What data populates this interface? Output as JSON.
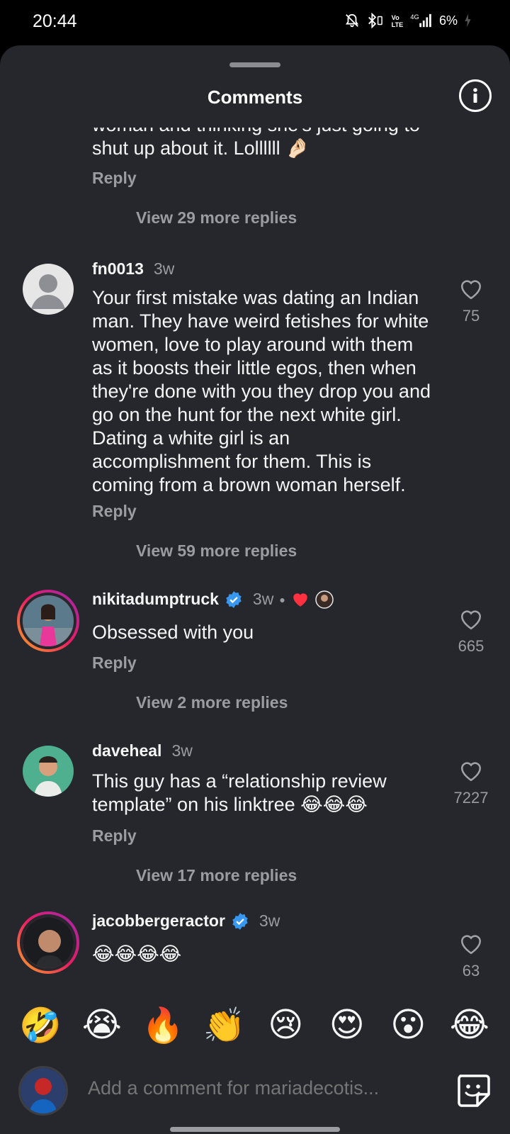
{
  "status": {
    "time": "20:44",
    "network": "4G",
    "battery": "6%",
    "icons": [
      "bell-off-icon",
      "bluetooth-icon",
      "volte-icon",
      "signal-icon",
      "battery-icon"
    ]
  },
  "sheet": {
    "title": "Comments"
  },
  "comments": [
    {
      "text_partial": "woman and thinking she's just going to shut up about it. Lollllll 🤌🏻",
      "reply_label": "Reply",
      "view_replies": "View 29 more replies"
    },
    {
      "username": "fn0013",
      "time": "3w",
      "text": "Your first mistake was dating an Indian man. They have weird fetishes for white women, love to play around with them as it boosts their little egos, then when they're done with you they drop you and go on the hunt for the next white girl. Dating a white girl is an accomplishment for them. This is coming from a brown woman herself.",
      "likes": "75",
      "reply_label": "Reply",
      "view_replies": "View 59 more replies"
    },
    {
      "username": "nikitadumptruck",
      "verified": true,
      "time": "3w",
      "text": "Obsessed with you",
      "likes": "665",
      "reply_label": "Reply",
      "view_replies": "View 2 more replies"
    },
    {
      "username": "daveheal",
      "time": "3w",
      "text": "This guy has a “relationship review template” on his linktree 😂😂😂",
      "likes": "7227",
      "reply_label": "Reply",
      "view_replies": "View 17 more replies"
    },
    {
      "username": "jacobbergeractor",
      "verified": true,
      "time": "3w",
      "text": "😂😂😂😂",
      "likes": "63"
    }
  ],
  "quick_emojis": [
    "🤣",
    "😭",
    "🔥",
    "👏",
    "😢",
    "😍",
    "😮",
    "😂"
  ],
  "composer": {
    "placeholder": "Add a comment for mariadecotis..."
  }
}
